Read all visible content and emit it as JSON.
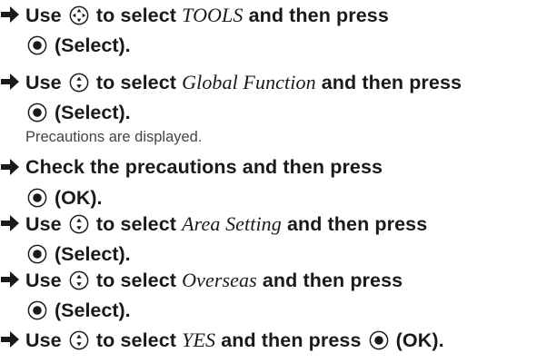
{
  "steps": [
    {
      "pre": "Use",
      "target": "TOOLS",
      "mid": "to select",
      "post": "and then press",
      "action": "(Select).",
      "pad": "multi"
    },
    {
      "pre": "Use",
      "target": "Global Function",
      "mid": "to select",
      "post": "and then press",
      "action": "(Select).",
      "pad": "updown",
      "note": "Precautions are displayed."
    },
    {
      "text": "Check the precautions and then press",
      "action": "(OK)."
    },
    {
      "pre": "Use",
      "target": "Area Setting",
      "mid": "to select",
      "post": "and then press",
      "action": "(Select).",
      "pad": "updown"
    },
    {
      "pre": "Use",
      "target": "Overseas",
      "mid": "to select",
      "post": "and then press",
      "action": "(Select).",
      "pad": "updown"
    },
    {
      "pre": "Use",
      "target": "YES",
      "mid": "to select",
      "post": "and then press",
      "action": "(OK).",
      "pad": "updown"
    }
  ],
  "icons": {
    "arrow": "right-arrow-icon",
    "multi": "multi-selector-icon",
    "updown": "up-down-selector-icon",
    "select": "center-select-button-icon"
  }
}
